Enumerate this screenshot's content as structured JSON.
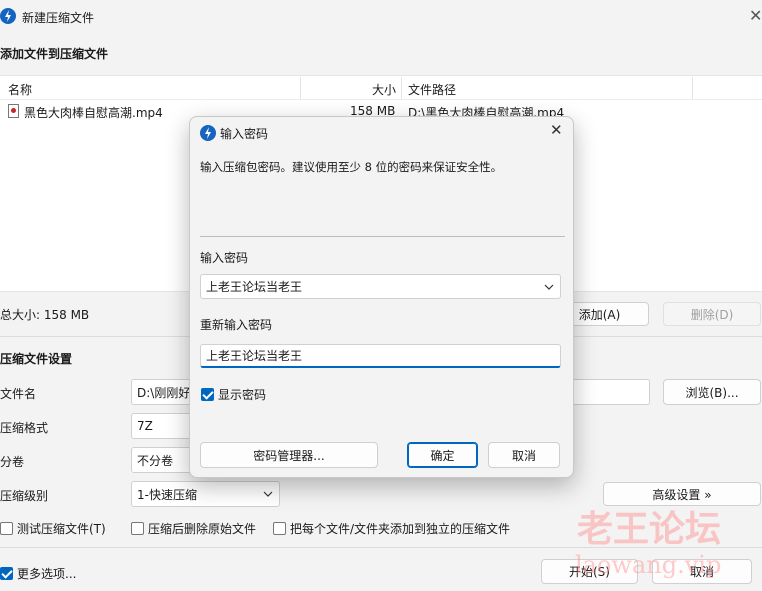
{
  "window": {
    "title": "新建压缩文件"
  },
  "main": {
    "section_title": "添加文件到压缩文件",
    "columns": {
      "name": "名称",
      "size": "大小",
      "path": "文件路径"
    },
    "files": [
      {
        "name": "黑色大肉棒自慰高潮.mp4",
        "size": "158 MB",
        "path": "D:\\黑色大肉棒自慰高潮.mp4"
      }
    ],
    "total_size": "总大小: 158 MB",
    "add_button": "添加(A)",
    "delete_button": "删除(D)",
    "settings_title": "压缩文件设置",
    "filename_label": "文件名",
    "filename_value": "D:\\刚刚好",
    "browse_button": "浏览(B)...",
    "format_label": "压缩格式",
    "format_value": "7Z",
    "split_label": "分卷",
    "split_value": "不分卷",
    "level_label": "压缩级别",
    "level_value": "1-快速压缩",
    "advanced_button": "高级设置 »",
    "test_checkbox": "测试压缩文件(T)",
    "delete_after_checkbox": "压缩后删除原始文件",
    "separate_checkbox": "把每个文件/文件夹添加到独立的压缩文件",
    "more_options": "更多选项...",
    "start_button": "开始(S)",
    "cancel_button": "取消"
  },
  "dialog": {
    "title": "输入密码",
    "description": "输入压缩包密码。建议使用至少 8 位的密码来保证安全性。",
    "password_label": "输入密码",
    "password_value": "上老王论坛当老王",
    "reenter_label": "重新输入密码",
    "reenter_value": "上老王论坛当老王",
    "show_password": "显示密码",
    "manager_button": "密码管理器...",
    "ok_button": "确定",
    "cancel_button": "取消"
  },
  "watermark": {
    "line1": "老王论坛",
    "line2": "laowang.vip"
  },
  "colors": {
    "accent": "#0067c0",
    "app_icon": "#1565c0",
    "watermark": "#ff9696"
  },
  "icons": {
    "app": "compress-app-icon",
    "close": "close-icon",
    "file": "video-file-icon"
  }
}
